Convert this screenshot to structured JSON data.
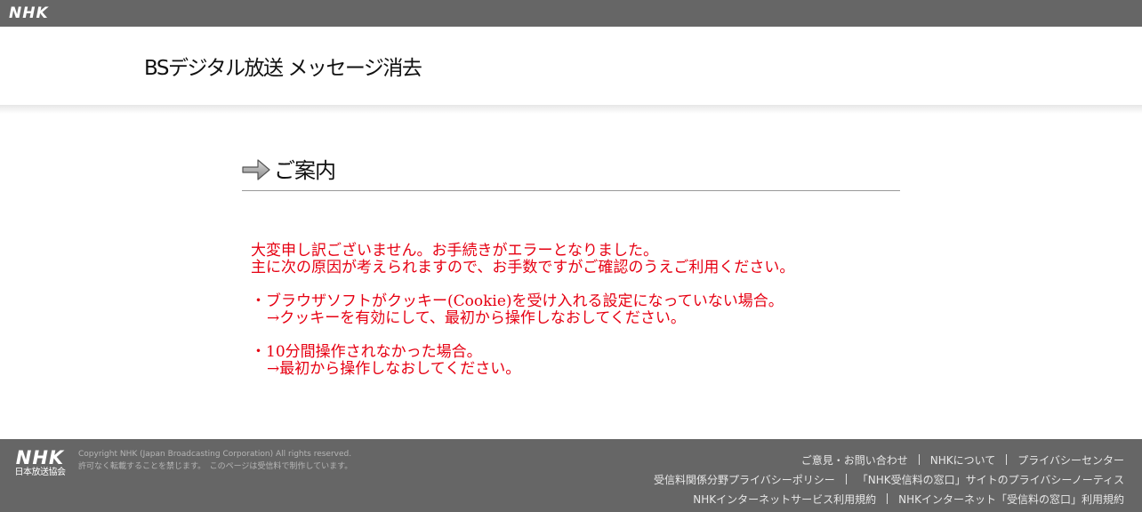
{
  "topbar": {
    "logo": "NHK"
  },
  "header": {
    "title": "BSデジタル放送 メッセージ消去"
  },
  "section": {
    "heading": "ご案内",
    "icon": "arrow-right-icon"
  },
  "message": {
    "color": "#e60012",
    "lines": [
      "大変申し訳ございません。お手続きがエラーとなりました。",
      "主に次の原因が考えられますので、お手数ですがご確認のうえご利用ください。",
      "・ブラウザソフトがクッキー(Cookie)を受け入れる設定になっていない場合。",
      "→クッキーを有効にして、最初から操作しなおしてください。",
      "・10分間操作されなかった場合。",
      "→最初から操作しなおしてください。"
    ]
  },
  "footer": {
    "logo": "NHK",
    "logo_sub": "日本放送協会",
    "copyright": "Copyright NHK (Japan Broadcasting Corporation) All rights reserved.",
    "notice": "許可なく転載することを禁じます。　このページは受信料で制作しています。",
    "links": [
      [
        "ご意見・お問い合わせ",
        "NHKについて",
        "プライバシーセンター"
      ],
      [
        "受信料関係分野プライバシーポリシー",
        "「NHK受信料の窓口」サイトのプライバシーノーティス"
      ],
      [
        "NHKインターネットサービス利用規約",
        "NHKインターネット「受信料の窓口」利用規約"
      ]
    ]
  }
}
